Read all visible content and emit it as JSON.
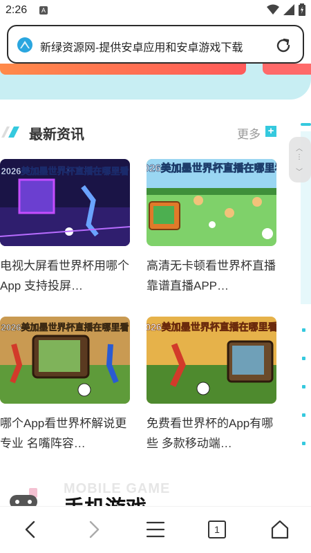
{
  "status_bar": {
    "time": "2:26",
    "app_icon": "A"
  },
  "url_bar": {
    "title": "新绿资源网-提供安卓应用和安卓游戏下载"
  },
  "news_section": {
    "title": "最新资讯",
    "more_label": "更多",
    "more_icon": "+"
  },
  "cards": [
    {
      "thumb_text": "2026美加墨世界杯直播在哪里看",
      "title": "电视大屏看世界杯用哪个App 支持投屏…"
    },
    {
      "thumb_text": "2026美加墨世界杯直播在哪里看",
      "title": "高清无卡顿看世界杯直播 靠谱直播APP…"
    },
    {
      "thumb_text": "2026美加墨世界杯直播在哪里看",
      "title": "哪个App看世界杯解说更专业 名嘴阵容…"
    },
    {
      "thumb_text": "026美加墨世界杯直播在哪里看",
      "title": "免费看世界杯的App有哪些 多款移动端…"
    }
  ],
  "mobile_game_section": {
    "subtitle": "MOBILE GAME",
    "title": "手机游戏"
  },
  "bottom_nav": {
    "tab_count": "1"
  },
  "colors": {
    "accent": "#35c9de",
    "banner_bg": "#c8eef3",
    "banner_bar": "#ff6a5a"
  },
  "icons": [
    "wifi-icon",
    "signal-icon",
    "battery-icon",
    "site-favicon-icon",
    "reload-icon",
    "back-arrow-icon",
    "forward-arrow-icon",
    "menu-icon",
    "tabs-icon",
    "home-icon"
  ]
}
